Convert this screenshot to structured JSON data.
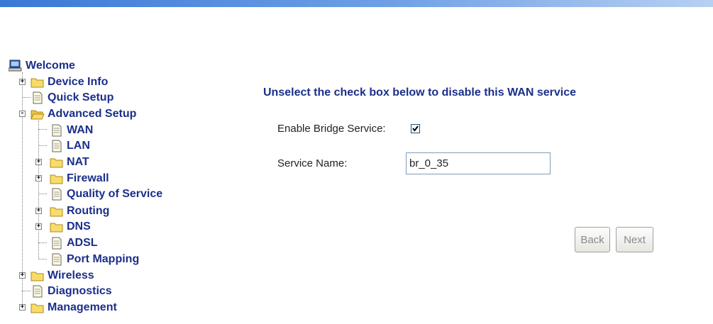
{
  "tree": {
    "root": {
      "label": "Welcome",
      "icon": "computer-icon"
    },
    "items": [
      {
        "label": "Device Info",
        "icon": "folder-icon",
        "expander": "+"
      },
      {
        "label": "Quick Setup",
        "icon": "page-icon"
      },
      {
        "label": "Advanced Setup",
        "icon": "open-folder-icon",
        "expander": "-"
      },
      {
        "label": "WAN",
        "icon": "page-icon"
      },
      {
        "label": "LAN",
        "icon": "page-icon"
      },
      {
        "label": "NAT",
        "icon": "folder-icon",
        "expander": "+"
      },
      {
        "label": "Firewall",
        "icon": "folder-icon",
        "expander": "+"
      },
      {
        "label": "Quality of Service",
        "icon": "page-icon"
      },
      {
        "label": "Routing",
        "icon": "folder-icon",
        "expander": "+"
      },
      {
        "label": "DNS",
        "icon": "folder-icon",
        "expander": "+"
      },
      {
        "label": "ADSL",
        "icon": "page-icon"
      },
      {
        "label": "Port Mapping",
        "icon": "page-icon"
      },
      {
        "label": "Wireless",
        "icon": "folder-icon",
        "expander": "+"
      },
      {
        "label": "Diagnostics",
        "icon": "page-icon"
      },
      {
        "label": "Management",
        "icon": "folder-icon",
        "expander": "+"
      }
    ]
  },
  "main": {
    "heading": "Unselect the check box below to disable this WAN service",
    "bridge_label": "Enable Bridge Service:",
    "bridge_checked": true,
    "service_name_label": "Service Name:",
    "service_name_value": "br_0_35",
    "back_label": "Back",
    "next_label": "Next"
  },
  "colors": {
    "link": "#1b2f8a",
    "banner": "#3a78d6"
  }
}
